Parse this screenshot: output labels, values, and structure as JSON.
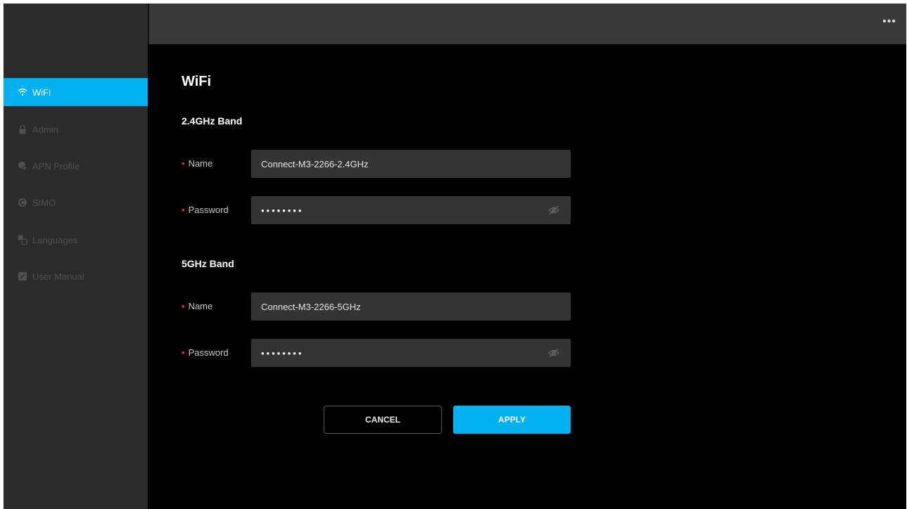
{
  "topbar": {
    "more_icon": "more-dots-icon",
    "more_label": "•••"
  },
  "sidebar": {
    "accent_color": "#00b0f0",
    "items": [
      {
        "label": "WiFi",
        "icon": "wifi-icon",
        "active": true
      },
      {
        "label": "Admin",
        "icon": "lock-icon",
        "active": false
      },
      {
        "label": "APN Profile",
        "icon": "apn-profile-icon",
        "active": false
      },
      {
        "label": "SIMO",
        "icon": "simo-icon",
        "active": false
      },
      {
        "label": "Languages",
        "icon": "languages-icon",
        "active": false
      },
      {
        "label": "User Manual",
        "icon": "user-manual-icon",
        "active": false
      }
    ]
  },
  "main": {
    "title": "WiFi",
    "band24": {
      "title": "2.4GHz Band",
      "name_label": "Name",
      "name_value": "Connect-M3-2266-2.4GHz",
      "password_label": "Password",
      "password_masked": "••••••••"
    },
    "band5": {
      "title": "5GHz Band",
      "name_label": "Name",
      "name_value": "Connect-M3-2266-5GHz",
      "password_label": "Password",
      "password_masked": "••••••••"
    },
    "required_marker": "•",
    "cancel_label": "CANCEL",
    "apply_label": "APPLY"
  }
}
